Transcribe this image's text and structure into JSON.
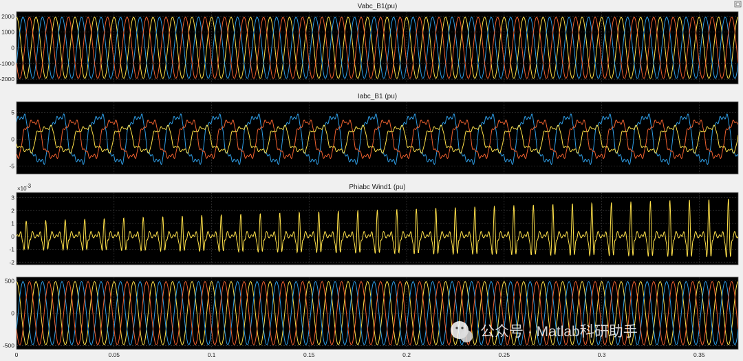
{
  "colors": {
    "axes_bg": "#000000",
    "figure_bg": "#f0f0f0",
    "grid": "#3a3a3a",
    "phase_a": "#ffe14a",
    "phase_b": "#2f9ee6",
    "phase_c": "#f0612f"
  },
  "toolbar": {
    "icon": "restore-axes-icon"
  },
  "watermark": {
    "icon": "wechat-icon",
    "text": "公众号 · Matlab科研助手"
  },
  "chart_data": [
    {
      "type": "line",
      "title": "Vabc_B1(pu)",
      "xlabel": "",
      "ylabel": "",
      "xlim": [
        0,
        0.37
      ],
      "ylim": [
        -2300,
        2300
      ],
      "yticks": [
        "2000",
        "1000",
        "0",
        "-1000",
        "-2000"
      ],
      "ytick_values": [
        2000,
        1000,
        0,
        -1000,
        -2000
      ],
      "grid": true,
      "series": [
        {
          "color": "#ffe14a",
          "waveform": "sine",
          "amplitude": 1950,
          "frequency_hz": 100,
          "phase_deg": 90
        },
        {
          "color": "#2f9ee6",
          "waveform": "sine",
          "amplitude": 1950,
          "frequency_hz": 100,
          "phase_deg": -30
        },
        {
          "color": "#f0612f",
          "waveform": "sine",
          "amplitude": 1950,
          "frequency_hz": 100,
          "phase_deg": 210
        }
      ]
    },
    {
      "type": "line",
      "title": "Iabc_B1 (pu)",
      "xlabel": "",
      "ylabel": "",
      "xlim": [
        0,
        0.37
      ],
      "ylim": [
        -6.5,
        7
      ],
      "yticks": [
        "5",
        "0",
        "-5"
      ],
      "ytick_values": [
        5,
        0,
        -5
      ],
      "grid": true,
      "series": [
        {
          "color": "#2f9ee6",
          "waveform": "distorted-sine",
          "amplitude": 4.6,
          "frequency_hz": 50,
          "phase_deg": 60,
          "harmonic3_ratio": 0.22,
          "harmonic5_ratio": 0.12,
          "peak_range": [
            -5.8,
            6.2
          ]
        },
        {
          "color": "#f0612f",
          "waveform": "distorted-sine",
          "amplitude": 3.6,
          "frequency_hz": 50,
          "phase_deg": -60,
          "harmonic3_ratio": 0.18,
          "harmonic5_ratio": 0.15,
          "peak_range": [
            -4.5,
            4.0
          ]
        },
        {
          "color": "#ffe14a",
          "waveform": "distorted-sine",
          "amplitude": 2.4,
          "frequency_hz": 50,
          "phase_deg": 180,
          "harmonic3_ratio": 0.25,
          "harmonic5_ratio": 0.2,
          "peak_range": [
            -2.5,
            2.8
          ]
        }
      ]
    },
    {
      "type": "line",
      "title": "Phiabc Wind1 (pu)",
      "xlabel": "",
      "ylabel": "",
      "xlim": [
        0,
        0.37
      ],
      "ylim": [
        -2.2,
        3.4
      ],
      "y_multiplier": "×10",
      "y_exponent": "-3",
      "yticks": [
        "3",
        "2",
        "1",
        "0",
        "-1",
        "-2"
      ],
      "ytick_values": [
        3,
        2,
        1,
        0,
        -1,
        -2
      ],
      "grid": true,
      "series": [
        {
          "color": "#ffe14a",
          "waveform": "pulse-train",
          "pulse_frequency_hz": 100,
          "peak_start": 1.2,
          "peak_end": 3.0,
          "trough_start": -1.1,
          "trough_end": -1.8,
          "minor_ripple": 0.35
        }
      ]
    },
    {
      "type": "line",
      "title": "",
      "xlabel": "",
      "ylabel": "",
      "xlim": [
        0,
        0.37
      ],
      "ylim": [
        -560,
        560
      ],
      "yticks": [
        "500",
        "0",
        "-500"
      ],
      "ytick_values": [
        500,
        0,
        -500
      ],
      "xticks": [
        "0",
        "0.05",
        "0.1",
        "0.15",
        "0.2",
        "0.25",
        "0.3",
        "0.35"
      ],
      "xtick_values": [
        0,
        0.05,
        0.1,
        0.15,
        0.2,
        0.25,
        0.3,
        0.35
      ],
      "grid": true,
      "series": [
        {
          "color": "#ffe14a",
          "waveform": "sine",
          "amplitude": 490,
          "frequency_hz": 100,
          "phase_deg": 90
        },
        {
          "color": "#2f9ee6",
          "waveform": "sine",
          "amplitude": 490,
          "frequency_hz": 100,
          "phase_deg": -30
        },
        {
          "color": "#f0612f",
          "waveform": "sine",
          "amplitude": 490,
          "frequency_hz": 100,
          "phase_deg": 210
        }
      ]
    }
  ]
}
